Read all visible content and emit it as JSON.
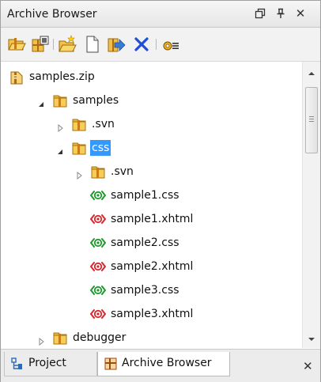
{
  "panel": {
    "title": "Archive Browser",
    "buttons": [
      "restore-icon",
      "pin-icon",
      "close-icon"
    ],
    "close_glyph": "✕"
  },
  "toolbar": {
    "tools": [
      "open-archive-icon",
      "archive-info-icon",
      "new-folder-icon",
      "new-file-icon",
      "add-file-icon",
      "delete-icon",
      "options-icon"
    ]
  },
  "tree": {
    "nodes": [
      {
        "label": "samples.zip",
        "icon": "zip-icon",
        "state": "leaf",
        "selected": false
      },
      {
        "label": "samples",
        "icon": "folder-icon",
        "state": "expanded",
        "selected": false
      },
      {
        "label": ".svn",
        "icon": "folder-icon",
        "state": "collapsed",
        "selected": false
      },
      {
        "label": "css",
        "icon": "folder-icon",
        "state": "expanded",
        "selected": true
      },
      {
        "label": ".svn",
        "icon": "folder-icon",
        "state": "collapsed",
        "selected": false
      },
      {
        "label": "sample1.css",
        "icon": "css-file-icon",
        "state": "leaf",
        "selected": false
      },
      {
        "label": "sample1.xhtml",
        "icon": "xhtml-file-icon",
        "state": "leaf",
        "selected": false
      },
      {
        "label": "sample2.css",
        "icon": "css-file-icon",
        "state": "leaf",
        "selected": false
      },
      {
        "label": "sample2.xhtml",
        "icon": "xhtml-file-icon",
        "state": "leaf",
        "selected": false
      },
      {
        "label": "sample3.css",
        "icon": "css-file-icon",
        "state": "leaf",
        "selected": false
      },
      {
        "label": "sample3.xhtml",
        "icon": "xhtml-file-icon",
        "state": "leaf",
        "selected": false
      },
      {
        "label": "debugger",
        "icon": "folder-icon",
        "state": "collapsed",
        "selected": false
      }
    ]
  },
  "tabs": {
    "project": "Project",
    "archive_browser": "Archive Browser",
    "close_glyph": "✕"
  },
  "colors": {
    "selection": "#3399ff",
    "folder": "#e8b83a",
    "css_icon": "#1e9a2c",
    "xhtml_icon": "#d8262c"
  }
}
